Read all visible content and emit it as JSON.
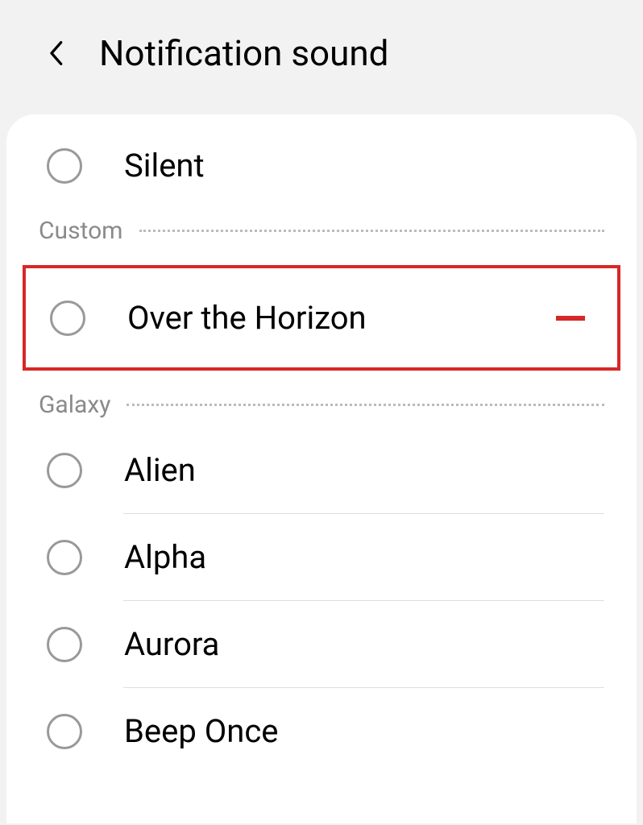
{
  "header": {
    "title": "Notification sound"
  },
  "options": {
    "silent": "Silent"
  },
  "sections": {
    "custom": {
      "label": "Custom",
      "items": [
        "Over the Horizon"
      ]
    },
    "galaxy": {
      "label": "Galaxy",
      "items": [
        "Alien",
        "Alpha",
        "Aurora",
        "Beep Once"
      ]
    }
  }
}
